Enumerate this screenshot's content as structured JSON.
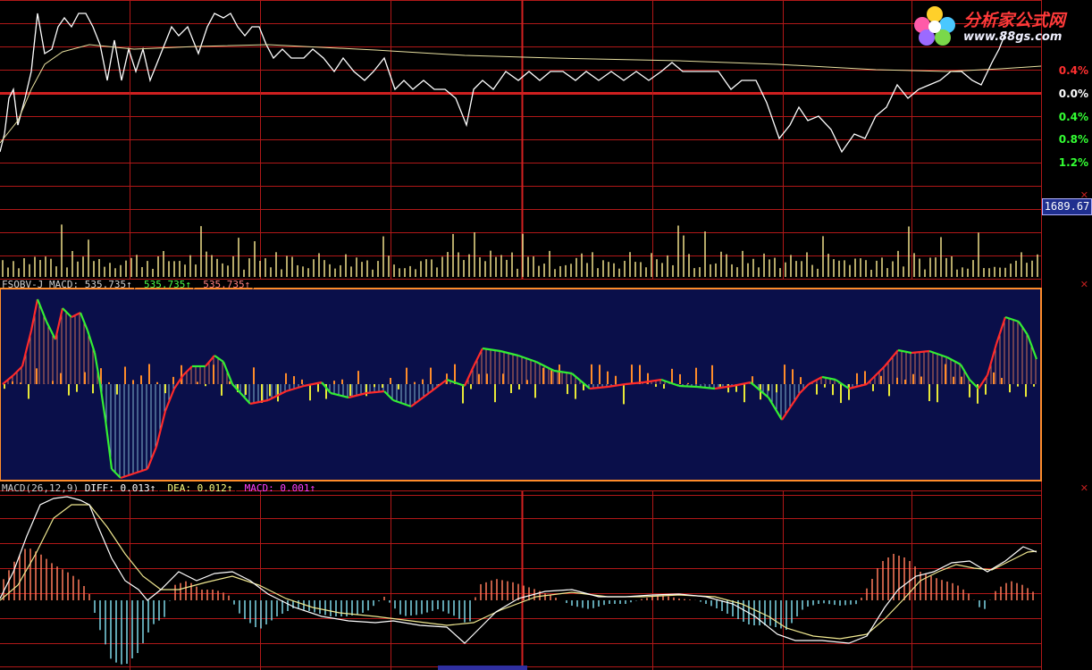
{
  "price_panel": {
    "axis_labels": [
      "0.4%",
      "0.0%",
      "0.4%",
      "0.8%",
      "1.2%"
    ],
    "axis_label_colors": [
      "#ff3030",
      "#ffffff",
      "#33ff33",
      "#33ff33",
      "#33ff33"
    ],
    "volume_value": "1689.67"
  },
  "logo": {
    "title": "分析家公式网",
    "url": "www.88gs.com"
  },
  "fsobv_header": {
    "name": "FSOBV-J",
    "macd_label": "MACD:",
    "value1": "535.735↑",
    "value2": "535.735↑",
    "value3": "535.735↑"
  },
  "macd_header": {
    "name": "MACD(26,12,9)",
    "diff_label": "DIFF:",
    "diff_value": "0.013↑",
    "dea_label": "DEA:",
    "dea_value": "0.012↑",
    "macd_label": "MACD:",
    "macd_value": "0.001↑"
  },
  "colors": {
    "grid": "#b01818",
    "price_line": "#ffffff",
    "avg_line": "#e8e0a0",
    "fsobv_bg": "#0a0f4a",
    "fsobv_border": "#ff8c2a",
    "up_bar": "#ff6a3a",
    "down_bar": "#7fd8e8",
    "volume_bar": "#f0e08a"
  }
}
